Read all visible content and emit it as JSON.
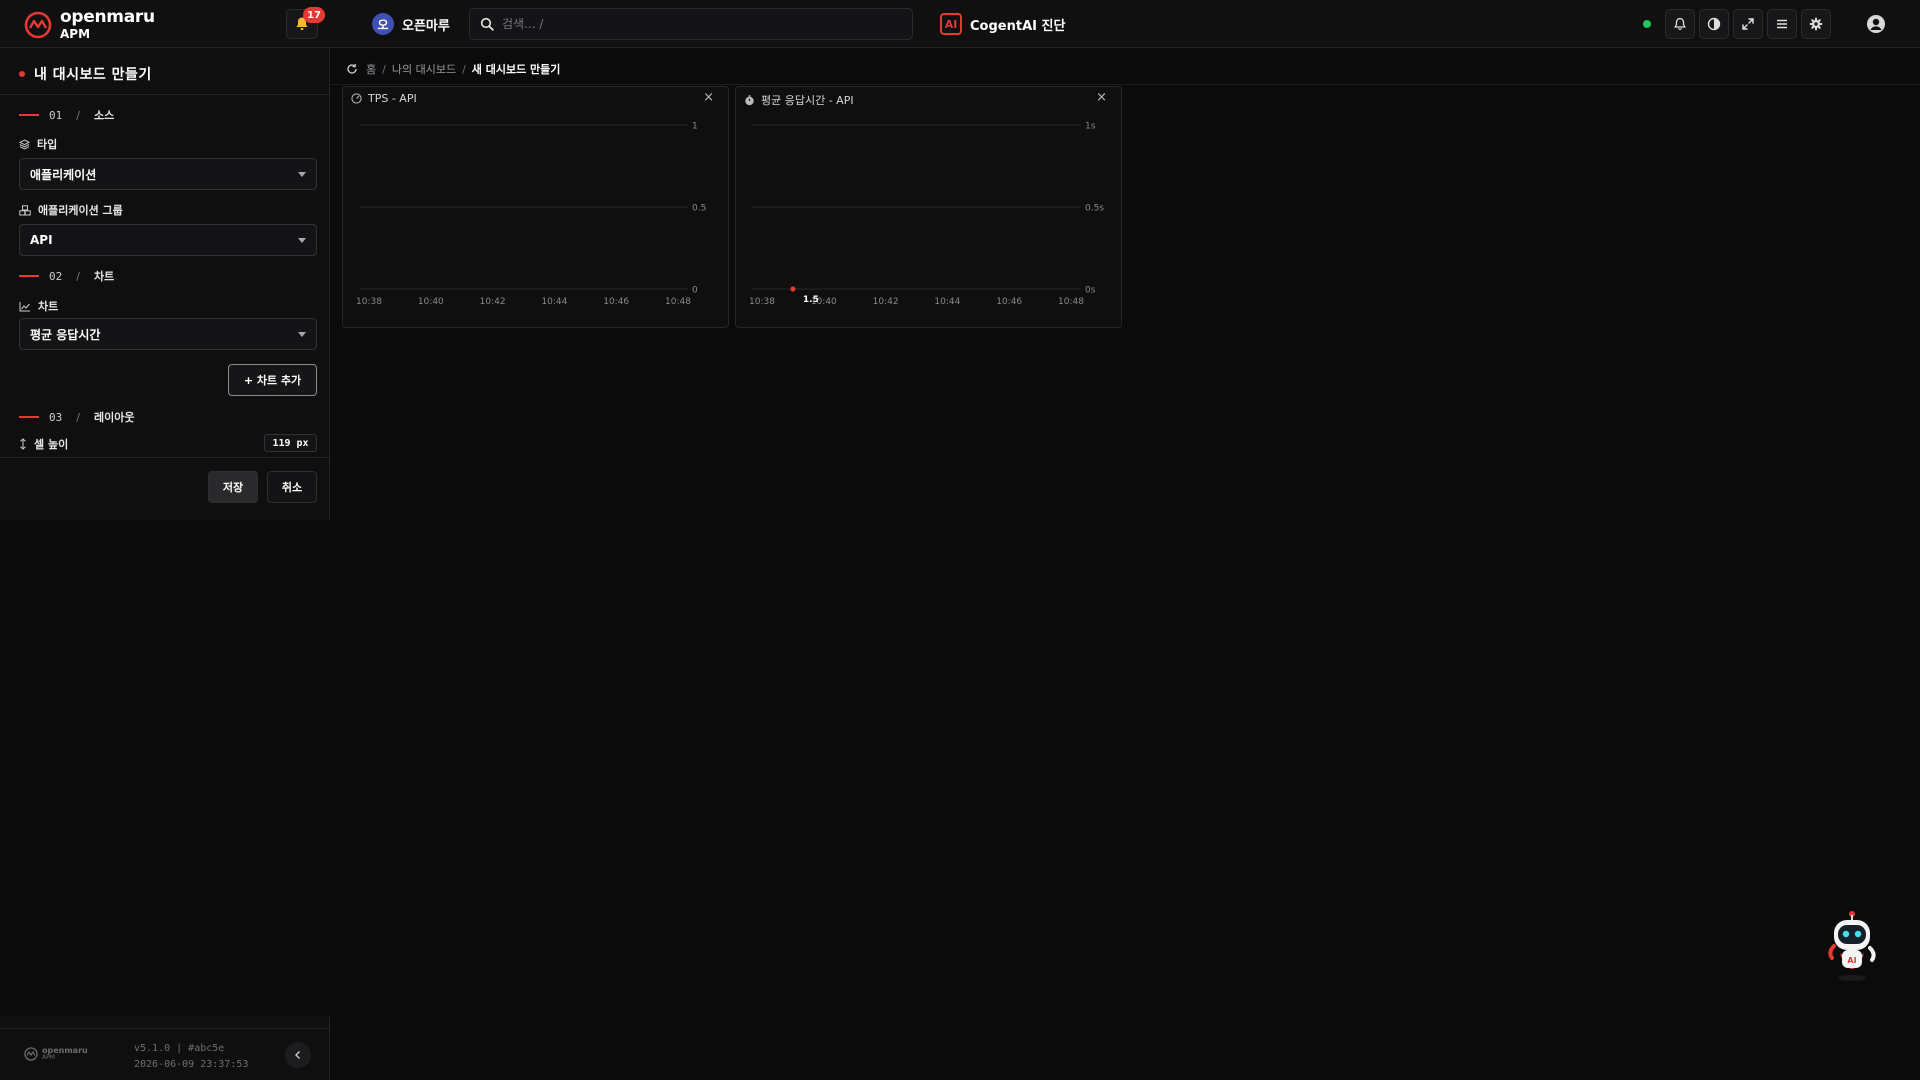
{
  "app": {
    "logo_name": "openmaru",
    "logo_product": "APM",
    "notification_count": "17",
    "workspace_initial": "오",
    "workspace_name": "오픈마루",
    "search_placeholder": "검색... /",
    "ai_badge": "AI",
    "ai_label": "CogentAI 진단",
    "status_color": "#22c55e",
    "accent_color": "#e53935"
  },
  "toolbar_icons": [
    "bell-icon",
    "contrast-icon",
    "expand-icon",
    "menu-icon",
    "gear-icon",
    "user-icon"
  ],
  "sidebar": {
    "title": "내 대시보드 만들기",
    "step1": {
      "num": "01",
      "sep": "/",
      "name": "소스"
    },
    "type_label": "타입",
    "type_value": "애플리케이션",
    "group_label": "애플리케이션 그룹",
    "group_value": "API",
    "step2": {
      "num": "02",
      "sep": "/",
      "name": "차트"
    },
    "chart_label": "차트",
    "chart_value": "평균 응답시간",
    "add_chart": "+ 차트 추가",
    "step3": {
      "num": "03",
      "sep": "/",
      "name": "레이아웃"
    },
    "cell_height_label": "셀 높이",
    "cell_height_value": "119 px",
    "save": "저장",
    "cancel": "취소",
    "footer_logo": "openmaru",
    "footer_logo_sub": "APM",
    "version": "v5.1.0 | #abc5e",
    "build_time": "2026-06-09 23:37:53"
  },
  "breadcrumb": {
    "home": "홈",
    "sep": "/",
    "level2": "나의 대시보드",
    "current": "새 대시보드 만들기"
  },
  "panels": [
    {
      "title": "TPS - API",
      "close": "×",
      "icon": "gauge-icon"
    },
    {
      "title": "평균 응답시간 - API",
      "close": "×",
      "icon": "timer-icon"
    }
  ],
  "chart_data": [
    {
      "type": "line",
      "x": [
        "10:38",
        "10:40",
        "10:42",
        "10:44",
        "10:46",
        "10:48"
      ],
      "yticks": [
        "0",
        "0.5",
        "1"
      ],
      "ylim": [
        0,
        1
      ],
      "series": [],
      "grid": true
    },
    {
      "type": "scatter",
      "x": [
        "10:38",
        "10:40",
        "10:42",
        "10:44",
        "10:46",
        "10:48"
      ],
      "yticks": [
        "0s",
        "0.5s",
        "1s"
      ],
      "ylim": [
        0,
        1
      ],
      "series": [
        {
          "points": [
            {
              "x": "10:39",
              "y": 0,
              "label": "1.5"
            }
          ]
        }
      ],
      "grid": true,
      "marker_color": "#e53935"
    }
  ]
}
